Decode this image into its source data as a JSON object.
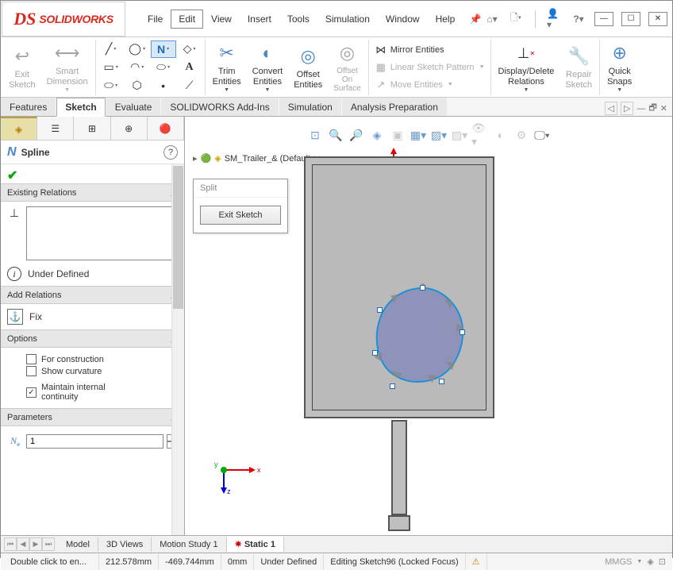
{
  "app": {
    "name": "SOLIDWORKS"
  },
  "menu": [
    "File",
    "Edit",
    "View",
    "Insert",
    "Tools",
    "Simulation",
    "Window",
    "Help"
  ],
  "menu_active": "Edit",
  "ribbon": {
    "exit_sketch": "Exit\nSketch",
    "smart_dim": "Smart\nDimension",
    "trim": "Trim\nEntities",
    "convert": "Convert\nEntities",
    "offset": "Offset\nEntities",
    "offset_surface": "Offset\nOn\nSurface",
    "mirror": "Mirror Entities",
    "pattern": "Linear Sketch Pattern",
    "move": "Move Entities",
    "disp_del": "Display/Delete\nRelations",
    "repair": "Repair\nSketch",
    "quick": "Quick\nSnaps"
  },
  "tabs": [
    "Features",
    "Sketch",
    "Evaluate",
    "SOLIDWORKS Add-Ins",
    "Simulation",
    "Analysis Preparation"
  ],
  "active_tab": "Sketch",
  "breadcrumb": "SM_Trailer_&  (Default<<...",
  "confirm": {
    "head": "Split",
    "button": "Exit Sketch"
  },
  "pm": {
    "title": "Spline",
    "existing": "Existing Relations",
    "under_defined": "Under Defined",
    "add_rel": "Add Relations",
    "fix": "Fix",
    "options": "Options",
    "for_construction": "For construction",
    "show_curvature": "Show curvature",
    "maintain": "Maintain internal\ncontinuity",
    "params": "Parameters",
    "param_value": "1"
  },
  "bottom_tabs": [
    "Model",
    "3D Views",
    "Motion Study 1",
    "Static 1"
  ],
  "active_bottom_tab": "Static 1",
  "status": {
    "hint": "Double click to en...",
    "x": "212.578mm",
    "y": "-469.744mm",
    "z": "0mm",
    "state": "Under Defined",
    "editing": "Editing Sketch96 (Locked Focus)",
    "units": "MMGS"
  }
}
